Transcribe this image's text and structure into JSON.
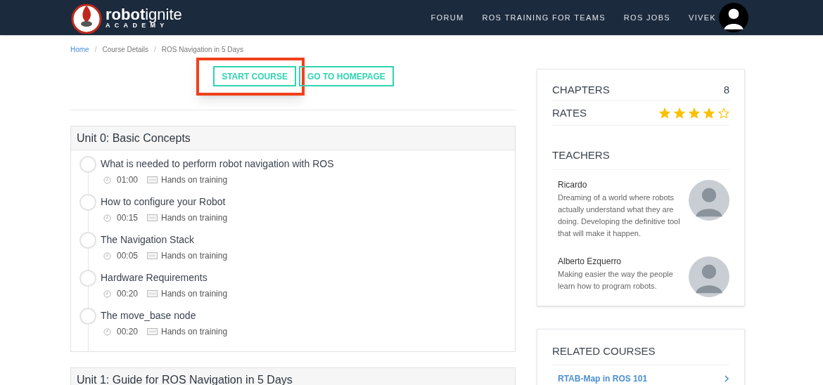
{
  "header": {
    "logo": {
      "word_bold": "robot",
      "word_light": "ignite",
      "subtitle": "ACADEMY"
    },
    "nav": [
      "FORUM",
      "ROS TRAINING FOR TEAMS",
      "ROS JOBS",
      "VIVEK"
    ]
  },
  "breadcrumb": {
    "separator": "/",
    "items": [
      {
        "label": "Home",
        "link": true
      },
      {
        "label": "Course Details",
        "link": false
      },
      {
        "label": "ROS Navigation in 5 Days",
        "link": false
      }
    ]
  },
  "actions": [
    {
      "label": "START COURSE",
      "highlighted": true
    },
    {
      "label": "GO TO HOMEPAGE",
      "highlighted": false
    }
  ],
  "units": [
    {
      "title": "Unit 0: Basic Concepts",
      "lessons": [
        {
          "title": "What is needed to perform robot navigation with ROS",
          "time": "01:00",
          "type": "Hands on training",
          "done": false
        },
        {
          "title": "How to configure your Robot",
          "time": "00:15",
          "type": "Hands on training",
          "done": false
        },
        {
          "title": "The Navigation Stack",
          "time": "00:05",
          "type": "Hands on training",
          "done": false
        },
        {
          "title": "Hardware Requirements",
          "time": "00:20",
          "type": "Hands on training",
          "done": false
        },
        {
          "title": "The move_base node",
          "time": "00:20",
          "type": "Hands on training",
          "done": false
        }
      ]
    },
    {
      "title": "Unit 1: Guide for ROS Navigation in 5 Days"
    }
  ],
  "info": {
    "chapters_label": "CHAPTERS",
    "chapters": "8",
    "rates_label": "RATES",
    "stars": 4
  },
  "teachers": {
    "title": "TEACHERS",
    "items": [
      {
        "name": "Ricardo",
        "bio": "Dreaming of a world where robots actually understand what they are doing. Developing the definitive tool that will make it happen."
      },
      {
        "name": "Alberto Ezquerro",
        "bio": "Making easier the way the people learn how to program robots."
      }
    ]
  },
  "related": {
    "title": "RELATED COURSES",
    "items": [
      "RTAB-Map in ROS 101"
    ]
  }
}
